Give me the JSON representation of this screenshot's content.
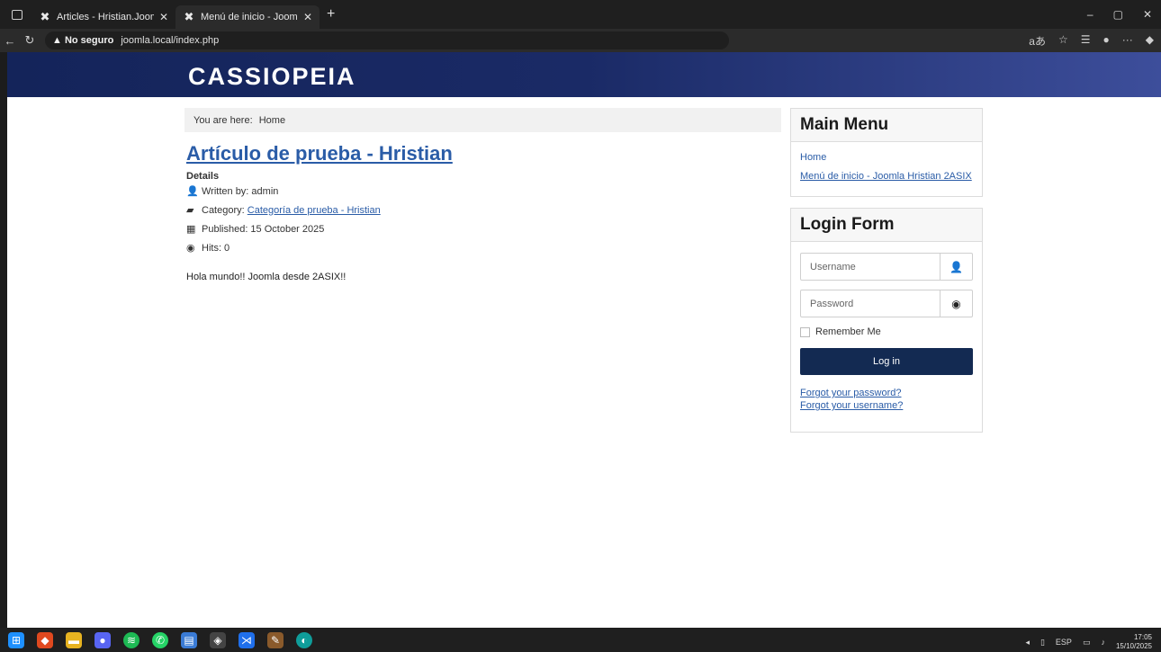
{
  "browser": {
    "tabs": [
      {
        "title": "Articles - Hristian.Joomla - Admin",
        "active": false
      },
      {
        "title": "Menú de inicio - Joomla Hristian",
        "active": true
      }
    ],
    "new_tab": "+",
    "url_warning": "▲ No seguro",
    "url": "joomla.local/index.php",
    "window_controls": [
      "–",
      "▢",
      "✕"
    ]
  },
  "site": {
    "brand": "CASSIOPEIA"
  },
  "breadcrumb": {
    "label": "You are here:",
    "current": "Home"
  },
  "article": {
    "title": "Artículo de prueba - Hristian",
    "details_label": "Details",
    "written_by": "Written by: admin",
    "category_label": "Category:",
    "category_link": "Categoría de prueba - Hristian",
    "published": "Published: 15 October 2025",
    "hits": "Hits: 0",
    "body": "Hola mundo!! Joomla desde 2ASIX!!"
  },
  "main_menu": {
    "title": "Main Menu",
    "items": [
      "Home",
      "Menú de inicio - Joomla Hristian 2ASIX"
    ]
  },
  "login_form": {
    "title": "Login Form",
    "username_placeholder": "Username",
    "password_placeholder": "Password",
    "remember_label": "Remember Me",
    "login_button": "Log in",
    "forgot_password": "Forgot your password?",
    "forgot_username": "Forgot your username?"
  },
  "system": {
    "language": "ESP",
    "time": "17:05",
    "date": "15/10/2025"
  },
  "colors": {
    "header_start": "#14245a",
    "header_end": "#3d4e9b",
    "link": "#2a5ca7",
    "login_button": "#132a52"
  }
}
